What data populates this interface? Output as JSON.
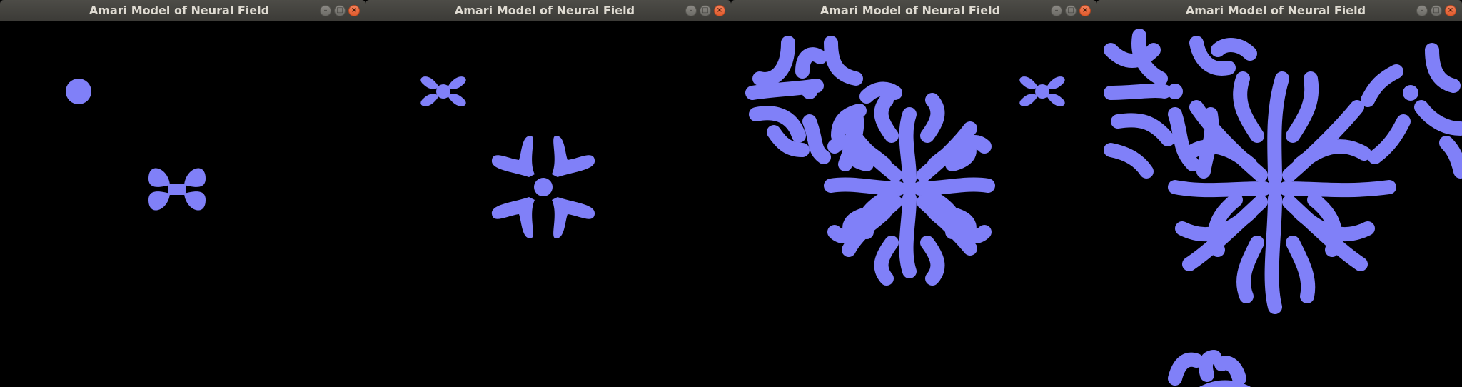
{
  "windows": [
    {
      "title": "Amari Model of Neural Field",
      "buttons": {
        "minimize": "–",
        "maximize": "□",
        "close": "×"
      }
    },
    {
      "title": "Amari Model of Neural Field",
      "buttons": {
        "minimize": "–",
        "maximize": "□",
        "close": "×"
      }
    },
    {
      "title": "Amari Model of Neural Field",
      "buttons": {
        "minimize": "–",
        "maximize": "□",
        "close": "×"
      }
    },
    {
      "title": "Amari Model of Neural Field",
      "buttons": {
        "minimize": "–",
        "maximize": "□",
        "close": "×"
      }
    }
  ],
  "colors": {
    "background": "#000000",
    "pattern_fill": "#8080f8",
    "titlebar": "#3c3b37",
    "close_button": "#e95420"
  }
}
